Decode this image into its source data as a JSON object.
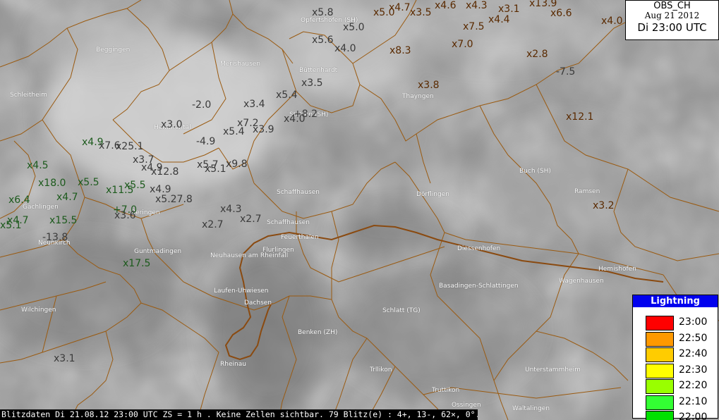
{
  "stamp": {
    "product": "OBS_CH",
    "date": "Aug 21 2012",
    "time": "Di 23:00 UTC"
  },
  "legend": {
    "title": "Lightning",
    "entries": [
      {
        "time": "23:00",
        "color": "#ff0000"
      },
      {
        "time": "22:50",
        "color": "#ff9900"
      },
      {
        "time": "22:40",
        "color": "#ffcc00"
      },
      {
        "time": "22:30",
        "color": "#ffff00"
      },
      {
        "time": "22:20",
        "color": "#99ff00"
      },
      {
        "time": "22:10",
        "color": "#33ff33"
      },
      {
        "time": "22:00",
        "color": "#00e000"
      }
    ]
  },
  "footer": "Blitzdaten Di 21.08.12 23:00 UTC  ZS = 1 h . Keine Zellen sichtbar. 79 Blitz(e) : 4+, 13-, 62×, 0°.",
  "places": [
    "Beggingen",
    "Schleitheim",
    "Merishausen",
    "Opfertshofen (SH)",
    "Büttenhardt",
    "Thayngen",
    "Hemmental",
    "Stetten (SH)",
    "Buch (SH)",
    "Ramsen",
    "Schaffhausen",
    "Dörflingen",
    "Gächlingen",
    "Neunkirch",
    "Beringen",
    "Schaffhausen",
    "Feuerthalen",
    "Flurlingen",
    "Neuhausen am Rheinfall",
    "Diessenhofen",
    "Hemishofen",
    "Wagenhausen",
    "Guntmadingen",
    "Basadingen-Schlattingen",
    "Laufen-Uhwiesen",
    "Dachsen",
    "Wilchingen",
    "Schlatt (TG)",
    "Benken (ZH)",
    "Rheinau",
    "Unterstammheim",
    "Trllikon",
    "Truttikon",
    "Ossingen",
    "Waltalingen"
  ],
  "strikes": [
    "x5.8",
    "x5.0",
    "x4.7",
    "x3.5",
    "x4.6",
    "x4.3",
    "x3.1",
    "x13.9",
    "x6.6",
    "x4.0",
    "x5.6",
    "x5.0",
    "x7.5",
    "x4.4",
    "x4.0",
    "x7.0",
    "x8.3",
    "x2.8",
    "-7.5",
    "x3.8",
    "x3.5",
    "x5.4",
    "x3.4",
    "-2.0",
    "+8.2",
    "x4.0",
    "x12.1",
    "x3.0",
    "x7.2",
    "x3.9",
    "x5.4",
    "x4.9",
    "x7.6",
    "x25.1",
    "-4.9",
    "x3.7",
    "x4.9",
    "x12.8",
    "x5.7",
    "x5.1",
    "x9.8",
    "x4.5",
    "x18.0",
    "x5.5",
    "x11.5",
    "x5.5",
    "x4.9",
    "x5.27.8",
    "x4.7",
    "x6.4",
    "+7.0",
    "x3.6",
    "x4.3",
    "x15.5",
    "x4.7",
    "x5.1",
    "x2.7",
    "x2.7",
    "-13.8",
    "x3.2",
    "x17.5",
    "x3.1"
  ]
}
